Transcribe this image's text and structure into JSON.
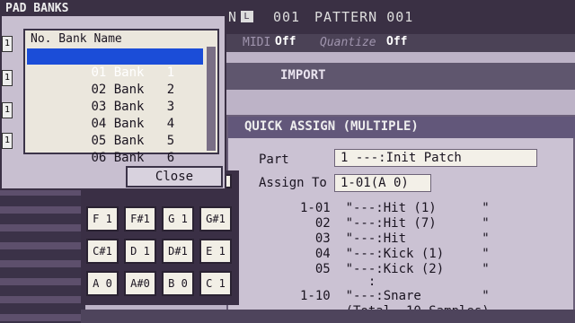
{
  "header": {
    "pattern_label": "N",
    "pattern_icon": "L",
    "pattern_number": "001",
    "pattern_name": "PATTERN 001"
  },
  "subbar": {
    "midi_label": "MIDI",
    "midi_value": "Off",
    "quantize_label": "Quantize",
    "quantize_value": "Off"
  },
  "import_bar": {
    "label": "IMPORT"
  },
  "quick_assign": {
    "title": "QUICK ASSIGN (MULTIPLE)",
    "part_label": "Part",
    "part_value": "1 ---:Init Patch",
    "assign_to_label": "Assign To",
    "assign_to_value": "1-01(A 0)",
    "lines": [
      "1-01  \"---:Hit (1)      \"",
      "  02  \"---:Hit (7)      \"",
      "  03  \"---:Hit          \"",
      "  04  \"---:Kick (1)     \"",
      "  05  \"---:Kick (2)     \"",
      "         :",
      "1-10  \"---:Snare        \"",
      "      (Total  10 Samples)"
    ]
  },
  "pad_banks": {
    "title": "PAD BANKS",
    "column_header": "No. Bank Name",
    "banks": [
      {
        "no": "01",
        "name": "Bank   1"
      },
      {
        "no": "02",
        "name": "Bank   2"
      },
      {
        "no": "03",
        "name": "Bank   3"
      },
      {
        "no": "04",
        "name": "Bank   4"
      },
      {
        "no": "05",
        "name": "Bank   5"
      },
      {
        "no": "06",
        "name": "Bank   6"
      }
    ],
    "selected_index": 0,
    "close_label": "Close",
    "side_labels": [
      "1",
      "1",
      "1",
      "1"
    ]
  },
  "pads": {
    "row1": [
      "F 1",
      "F#1",
      "G 1",
      "G#1"
    ],
    "row2": [
      "C#1",
      "D 1",
      "D#1",
      "E 1"
    ],
    "row3": [
      "A 0",
      "A#0",
      "B 0",
      "C 1"
    ]
  },
  "colors": {
    "selection": "#1b4dd8",
    "dialog_title": "#62577a"
  }
}
